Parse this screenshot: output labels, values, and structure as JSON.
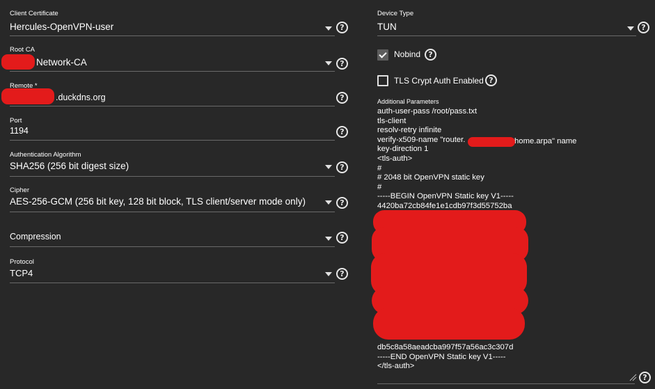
{
  "left": {
    "client_certificate": {
      "label": "Client Certificate",
      "value": "Hercules-OpenVPN-user"
    },
    "root_ca": {
      "label": "Root CA",
      "value": "Network-CA"
    },
    "remote": {
      "label": "Remote *",
      "value": ".duckdns.org"
    },
    "port": {
      "label": "Port",
      "value": "1194"
    },
    "auth_algorithm": {
      "label": "Authentication Algorithm",
      "value": "SHA256 (256 bit digest size)"
    },
    "cipher": {
      "label": "Cipher",
      "value": "AES-256-GCM (256 bit key, 128 bit block, TLS client/server mode only)"
    },
    "compression": {
      "label": "Compression",
      "value": ""
    },
    "protocol": {
      "label": "Protocol",
      "value": "TCP4"
    }
  },
  "right": {
    "device_type": {
      "label": "Device Type",
      "value": "TUN"
    },
    "nobind": {
      "label": "Nobind",
      "checked": true
    },
    "tls_crypt": {
      "label": "TLS Crypt Auth Enabled",
      "checked": false
    },
    "additional_parameters": {
      "label": "Additional Parameters",
      "lines": [
        "auth-user-pass /root/pass.txt",
        "tls-client",
        "resolv-retry infinite",
        "verify-x509-name \"router.",
        "key-direction 1",
        "<tls-auth>",
        "#",
        "# 2048 bit OpenVPN static key",
        "#",
        "-----BEGIN OpenVPN Static key V1-----",
        "4420ba72cb84fe1e1cdb97f3d55752ba"
      ],
      "verify_suffix": "home.arpa\" name",
      "tail_lines": [
        "db5c8a58aeadcba997f57a56ac3c307d",
        "-----END OpenVPN Static key V1-----",
        "</tls-auth>"
      ]
    }
  },
  "icons": {
    "help": "?"
  },
  "colors": {
    "background": "#282828",
    "redaction": "#e31b1b",
    "underline": "#6a6a6a"
  }
}
